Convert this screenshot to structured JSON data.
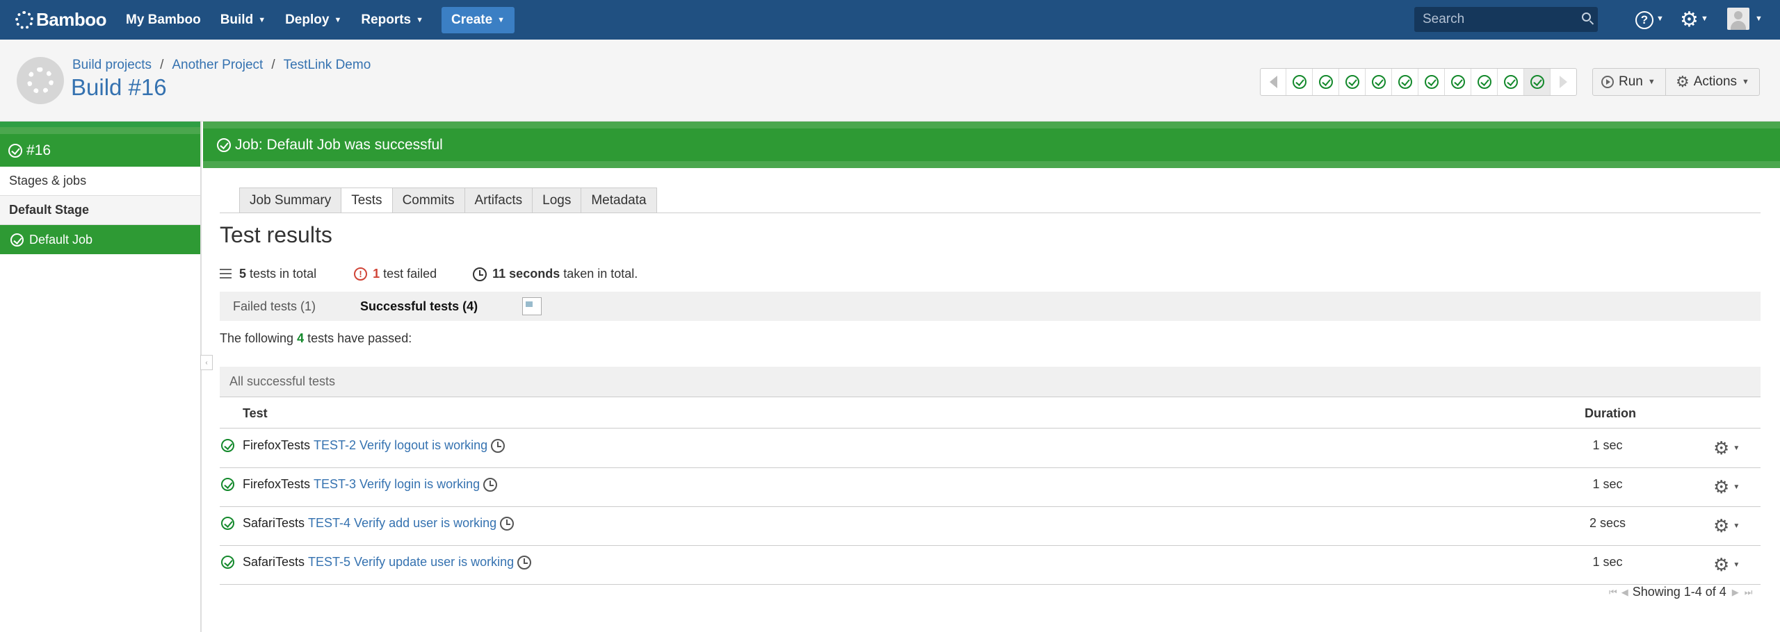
{
  "nav": {
    "logo": "Bamboo",
    "links": [
      "My Bamboo",
      "Build",
      "Deploy",
      "Reports"
    ],
    "create_label": "Create",
    "search_placeholder": "Search"
  },
  "header": {
    "breadcrumbs": [
      "Build projects",
      "Another Project",
      "TestLink Demo"
    ],
    "title": "Build #16",
    "history_results": [
      "success",
      "success",
      "success",
      "success",
      "success",
      "success",
      "success",
      "success",
      "success",
      "success"
    ],
    "run_label": "Run",
    "actions_label": "Actions"
  },
  "sidebar": {
    "build_number": "#16",
    "stages_jobs_label": "Stages & jobs",
    "stage_name": "Default Stage",
    "job_name": "Default Job"
  },
  "main": {
    "status_text": "Job: Default Job was successful",
    "tabs": [
      "Job Summary",
      "Tests",
      "Commits",
      "Artifacts",
      "Logs",
      "Metadata"
    ],
    "active_tab": "Tests",
    "title": "Test results",
    "summary": {
      "total_num": "5",
      "total_text": "tests in total",
      "failed_num": "1",
      "failed_text": "test failed",
      "time_num": "11 seconds",
      "time_text": "taken in total."
    },
    "subtabs": {
      "failed": "Failed tests (1)",
      "successful": "Successful tests (4)"
    },
    "passed_prefix": "The following",
    "passed_num": "4",
    "passed_suffix": "tests have passed:",
    "section_title": "All successful tests",
    "columns": {
      "test": "Test",
      "duration": "Duration"
    },
    "rows": [
      {
        "class": "FirefoxTests",
        "name": "TEST-2 Verify logout is working",
        "duration": "1 sec"
      },
      {
        "class": "FirefoxTests",
        "name": "TEST-3 Verify login is working",
        "duration": "1 sec"
      },
      {
        "class": "SafariTests",
        "name": "TEST-4 Verify add user is working",
        "duration": "2 secs"
      },
      {
        "class": "SafariTests",
        "name": "TEST-5 Verify update user is working",
        "duration": "1 sec"
      }
    ],
    "pager_text": "Showing 1-4 of 4"
  },
  "colors": {
    "nav_bg": "#205081",
    "success_green": "#14892c",
    "link_blue": "#3572b0",
    "error_red": "#d04437"
  },
  "icons": {
    "help": "help-icon",
    "settings": "gear-icon",
    "success": "check-circle-icon",
    "history": "clock-icon"
  }
}
